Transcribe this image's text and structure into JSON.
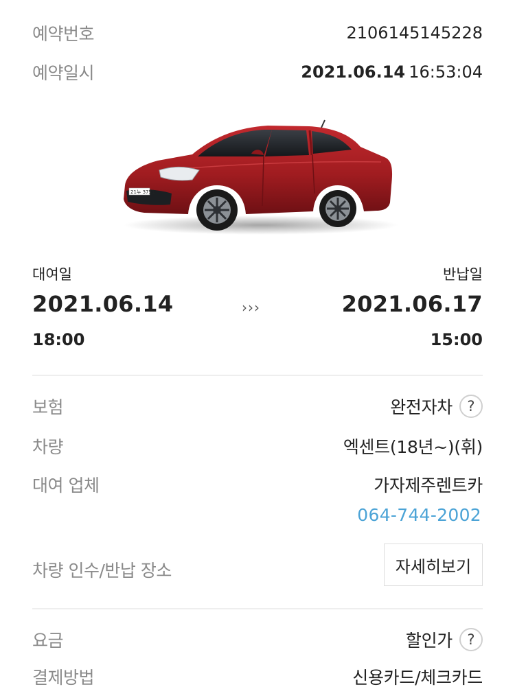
{
  "reservation": {
    "number_label": "예약번호",
    "number_value": "2106145145228",
    "date_label": "예약일시",
    "date_value": "2021.06.14",
    "time_value": "16:53:04"
  },
  "car_image": {
    "plate": "21누 3751"
  },
  "schedule": {
    "pickup_label": "대여일",
    "pickup_date": "2021.06.14",
    "pickup_time": "18:00",
    "arrow": "›››",
    "return_label": "반납일",
    "return_date": "2021.06.17",
    "return_time": "15:00"
  },
  "details": {
    "insurance_label": "보험",
    "insurance_value": "완전자차",
    "vehicle_label": "차량",
    "vehicle_value": "엑센트(18년~)(휘)",
    "company_label": "대여 업체",
    "company_value": "가자제주렌트카",
    "company_phone": "064-744-2002",
    "location_label": "차량 인수/반납 장소",
    "location_button": "자세히보기"
  },
  "pricing": {
    "fee_label": "요금",
    "fee_value": "할인가",
    "payment_label": "결제방법",
    "payment_value": "신용카드/체크카드"
  },
  "icons": {
    "help": "?"
  },
  "colors": {
    "car_body": "#a01c20",
    "phone_link": "#4ba3d6",
    "label_gray": "#8a8a8a"
  }
}
